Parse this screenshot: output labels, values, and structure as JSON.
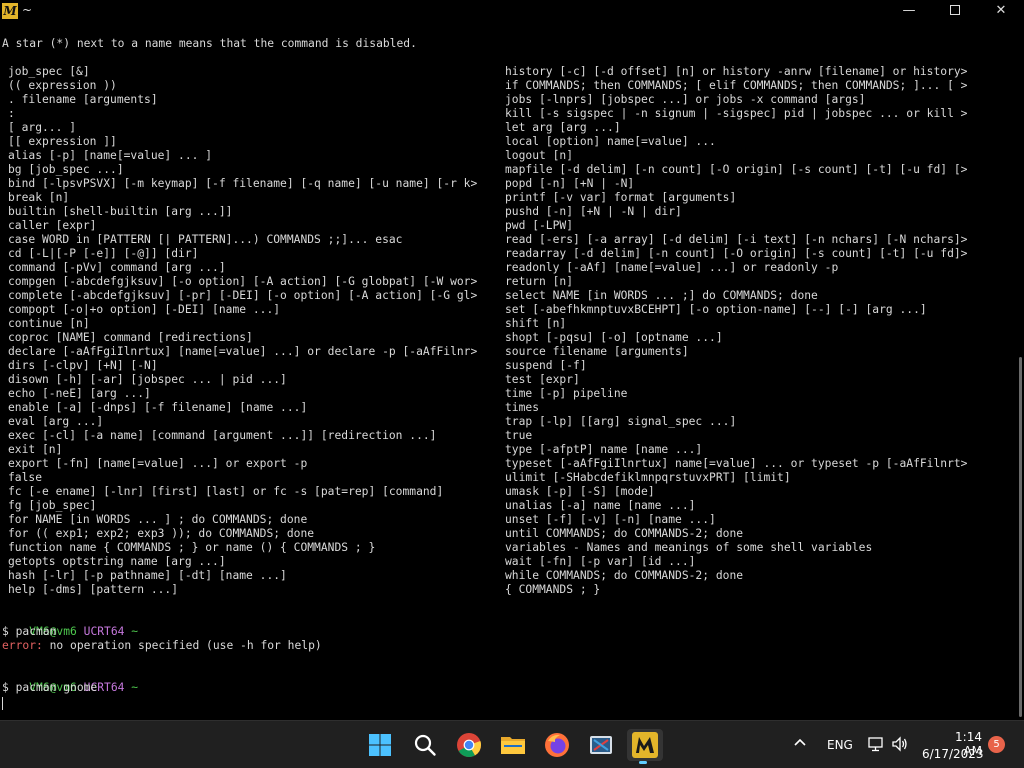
{
  "window": {
    "title": "~",
    "app_icon_letter": "M",
    "minimize": "—",
    "close": "✕"
  },
  "terminal": {
    "header": "A star (*) next to a name means that the command is disabled.",
    "left_column": [
      "job_spec [&]",
      "(( expression ))",
      ". filename [arguments]",
      ":",
      "[ arg... ]",
      "[[ expression ]]",
      "alias [-p] [name[=value] ... ]",
      "bg [job_spec ...]",
      "bind [-lpsvPSVX] [-m keymap] [-f filename] [-q name] [-u name] [-r k>",
      "break [n]",
      "builtin [shell-builtin [arg ...]]",
      "caller [expr]",
      "case WORD in [PATTERN [| PATTERN]...) COMMANDS ;;]... esac",
      "cd [-L|[-P [-e]] [-@]] [dir]",
      "command [-pVv] command [arg ...]",
      "compgen [-abcdefgjksuv] [-o option] [-A action] [-G globpat] [-W wor>",
      "complete [-abcdefgjksuv] [-pr] [-DEI] [-o option] [-A action] [-G gl>",
      "compopt [-o|+o option] [-DEI] [name ...]",
      "continue [n]",
      "coproc [NAME] command [redirections]",
      "declare [-aAfFgiIlnrtux] [name[=value] ...] or declare -p [-aAfFilnr>",
      "dirs [-clpv] [+N] [-N]",
      "disown [-h] [-ar] [jobspec ... | pid ...]",
      "echo [-neE] [arg ...]",
      "enable [-a] [-dnps] [-f filename] [name ...]",
      "eval [arg ...]",
      "exec [-cl] [-a name] [command [argument ...]] [redirection ...]",
      "exit [n]",
      "export [-fn] [name[=value] ...] or export -p",
      "false",
      "fc [-e ename] [-lnr] [first] [last] or fc -s [pat=rep] [command]",
      "fg [job_spec]",
      "for NAME [in WORDS ... ] ; do COMMANDS; done",
      "for (( exp1; exp2; exp3 )); do COMMANDS; done",
      "function name { COMMANDS ; } or name () { COMMANDS ; }",
      "getopts optstring name [arg ...]",
      "hash [-lr] [-p pathname] [-dt] [name ...]",
      "help [-dms] [pattern ...]"
    ],
    "right_column": [
      "history [-c] [-d offset] [n] or history -anrw [filename] or history>",
      "if COMMANDS; then COMMANDS; [ elif COMMANDS; then COMMANDS; ]... [ >",
      "jobs [-lnprs] [jobspec ...] or jobs -x command [args]",
      "kill [-s sigspec | -n signum | -sigspec] pid | jobspec ... or kill >",
      "let arg [arg ...]",
      "local [option] name[=value] ...",
      "logout [n]",
      "mapfile [-d delim] [-n count] [-O origin] [-s count] [-t] [-u fd] [>",
      "popd [-n] [+N | -N]",
      "printf [-v var] format [arguments]",
      "pushd [-n] [+N | -N | dir]",
      "pwd [-LPW]",
      "read [-ers] [-a array] [-d delim] [-i text] [-n nchars] [-N nchars]>",
      "readarray [-d delim] [-n count] [-O origin] [-s count] [-t] [-u fd]>",
      "readonly [-aAf] [name[=value] ...] or readonly -p",
      "return [n]",
      "select NAME [in WORDS ... ;] do COMMANDS; done",
      "set [-abefhkmnptuvxBCEHPT] [-o option-name] [--] [-] [arg ...]",
      "shift [n]",
      "shopt [-pqsu] [-o] [optname ...]",
      "source filename [arguments]",
      "suspend [-f]",
      "test [expr]",
      "time [-p] pipeline",
      "times",
      "trap [-lp] [[arg] signal_spec ...]",
      "true",
      "type [-afptP] name [name ...]",
      "typeset [-aAfFgiIlnrtux] name[=value] ... or typeset -p [-aAfFilnrt>",
      "ulimit [-SHabcdefiklmnpqrstuvxPRT] [limit]",
      "umask [-p] [-S] [mode]",
      "unalias [-a] name [name ...]",
      "unset [-f] [-v] [-n] [name ...]",
      "until COMMANDS; do COMMANDS-2; done",
      "variables - Names and meanings of some shell variables",
      "wait [-fn] [-p var] [id ...]",
      "while COMMANDS; do COMMANDS-2; done",
      "{ COMMANDS ; }"
    ],
    "prompt1": {
      "user_host": "VM6@vm6",
      "env": "UCRT64",
      "dir": "~",
      "command": "$ pacman"
    },
    "error_line": {
      "label": "error:",
      "message": " no operation specified (use -h for help)"
    },
    "prompt2": {
      "user_host": "VM6@vm6",
      "env": "UCRT64",
      "dir": "~",
      "command": "$ pacman gnome"
    }
  },
  "taskbar": {
    "apps": [
      {
        "name": "start",
        "icon": "windows-logo-icon"
      },
      {
        "name": "search",
        "icon": "search-icon"
      },
      {
        "name": "chrome",
        "icon": "chrome-icon"
      },
      {
        "name": "file-explorer",
        "icon": "folder-icon"
      },
      {
        "name": "firefox",
        "icon": "firefox-icon"
      },
      {
        "name": "snipping-tool",
        "icon": "snipping-tool-icon"
      },
      {
        "name": "msys2",
        "icon": "msys2-icon",
        "active": true
      }
    ],
    "tray": {
      "language": "ENG",
      "time": "1:14 AM",
      "date": "6/17/2023",
      "notification_count": "5"
    },
    "colors": {
      "accent": "#60cdff",
      "taskbar_bg": "#202020"
    }
  }
}
